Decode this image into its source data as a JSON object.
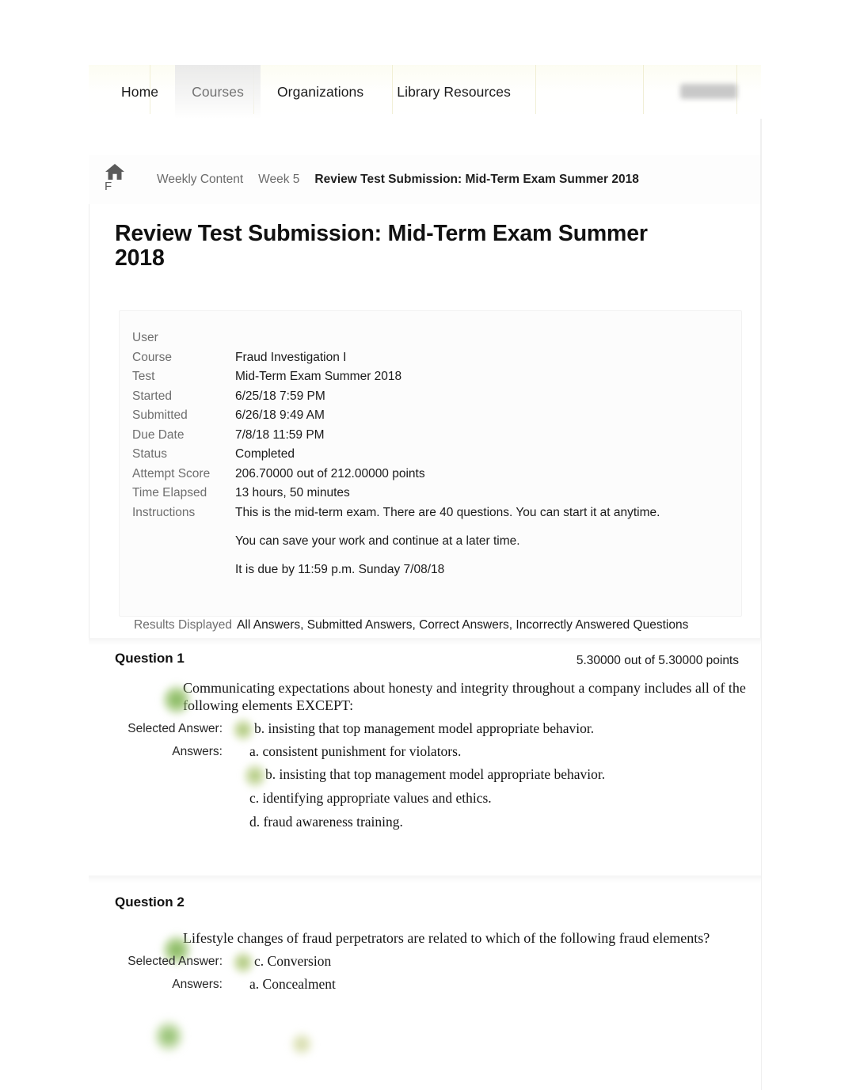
{
  "global_nav": {
    "items": [
      {
        "label": "Home",
        "active": false
      },
      {
        "label": "Courses",
        "active": true
      },
      {
        "label": "Organizations",
        "active": false
      },
      {
        "label": "Library Resources",
        "active": false
      }
    ],
    "redacted_name": ""
  },
  "breadcrumb": {
    "home_icon": "home-icon",
    "home_icon_letter": "F",
    "items": [
      {
        "label": "Weekly Content",
        "current": false
      },
      {
        "label": "Week 5",
        "current": false
      },
      {
        "label": "Review Test Submission: Mid-Term Exam Summer 2018",
        "current": true
      }
    ]
  },
  "page": {
    "title": "Review Test Submission: Mid-Term Exam Summer 2018"
  },
  "info": {
    "rows": [
      {
        "label": "User",
        "value": ""
      },
      {
        "label": "Course",
        "value": "Fraud Investigation I"
      },
      {
        "label": "Test",
        "value": "Mid-Term Exam Summer 2018"
      },
      {
        "label": "Started",
        "value": "6/25/18 7:59 PM"
      },
      {
        "label": "Submitted",
        "value": "6/26/18 9:49 AM"
      },
      {
        "label": "Due Date",
        "value": "7/8/18 11:59 PM"
      },
      {
        "label": "Status",
        "value": "Completed"
      },
      {
        "label": "Attempt Score",
        "value": "206.70000 out of 212.00000 points"
      },
      {
        "label": "Time Elapsed",
        "value": "13 hours, 50 minutes"
      }
    ],
    "instructions_label": "Instructions",
    "instructions": [
      "This is the mid-term exam. There are 40 questions. You can start it at anytime.",
      "You can save your work and continue at a later time.",
      "It is due by 11:59 p.m. Sunday 7/08/18"
    ],
    "results_displayed_label": "Results Displayed",
    "results_displayed_value": "All Answers, Submitted Answers, Correct Answers, Incorrectly Answered Questions"
  },
  "questions": [
    {
      "header": "Question 1",
      "score": "5.30000 out of 5.30000 points",
      "prompt": "Communicating expectations about honesty and integrity throughout a company includes all of the following elements EXCEPT:",
      "selected_answer_label": "Selected Answer:",
      "selected_answer_text": "b. insisting that top management model appropriate behavior.",
      "selected_answer_correct": true,
      "answers_label": "Answers:",
      "options": [
        {
          "text": "a. consistent punishment for violators.",
          "correct": false
        },
        {
          "text": "b. insisting that top management model appropriate behavior.",
          "correct": true
        },
        {
          "text": "c. identifying appropriate values and ethics.",
          "correct": false
        },
        {
          "text": "d. fraud awareness training.",
          "correct": false
        }
      ]
    },
    {
      "header": "Question 2",
      "score": "",
      "prompt": "Lifestyle changes of fraud perpetrators are related to which of the following fraud elements?",
      "selected_answer_label": "Selected Answer:",
      "selected_answer_text": "c. Conversion",
      "selected_answer_correct": true,
      "answers_label": "Answers:",
      "options": [
        {
          "text": "a. Concealment",
          "correct": false
        }
      ]
    }
  ],
  "colors": {
    "correct_marker": "#77af4e",
    "nav_active_text": "#737373",
    "label_gray": "#6e6e6e",
    "body_text": "#1a1a1a"
  }
}
